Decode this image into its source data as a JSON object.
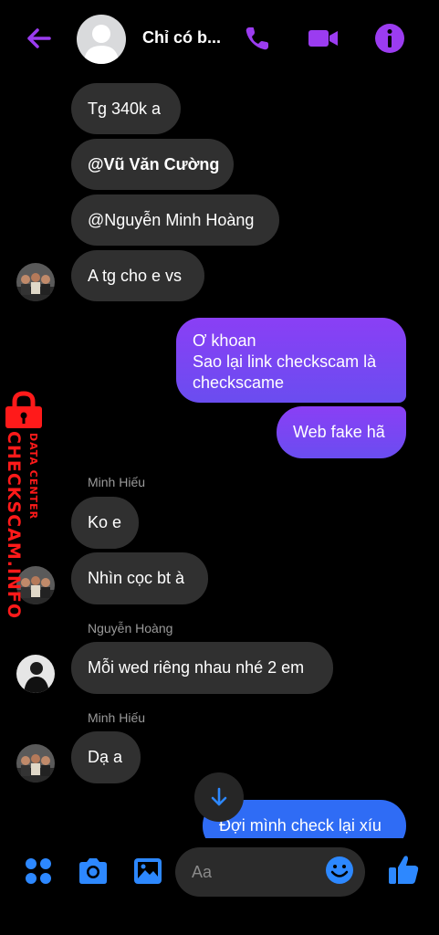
{
  "header": {
    "title": "Chỉ có b...",
    "accent_color": "#9b3cf0",
    "icons": [
      "arrow-back-icon",
      "phone-icon",
      "video-camera-icon",
      "info-icon"
    ]
  },
  "messages": [
    {
      "text": "Tg 340k a"
    },
    {
      "text": "@Vũ Văn Cường"
    },
    {
      "text": "@Nguyễn Minh Hoàng"
    },
    {
      "text": "A tg cho e vs"
    },
    {
      "lines": [
        "Ơ khoan",
        "Sao lại link checkscam là",
        "checkscame"
      ]
    },
    {
      "text": "Web fake hã"
    },
    {
      "sender": "Minh Hiếu",
      "text": "Ko e"
    },
    {
      "text": "Nhìn cọc bt à"
    },
    {
      "sender": "Nguyễn Hoàng",
      "text": "Mỗi wed riêng nhau nhé 2 em"
    },
    {
      "sender": "Minh Hiếu",
      "text": "Dạ a"
    },
    {
      "text": "Đợi mình check lại xíu"
    }
  ],
  "watermark": {
    "line1": "DATA CENTER",
    "line2": "CHECKSCAM.INFO"
  },
  "composer": {
    "placeholder": "Aa",
    "accent_color": "#2d88ff",
    "icons": [
      "apps-grid-icon",
      "camera-icon",
      "gallery-icon",
      "emoji-icon",
      "thumbs-up-icon"
    ]
  }
}
